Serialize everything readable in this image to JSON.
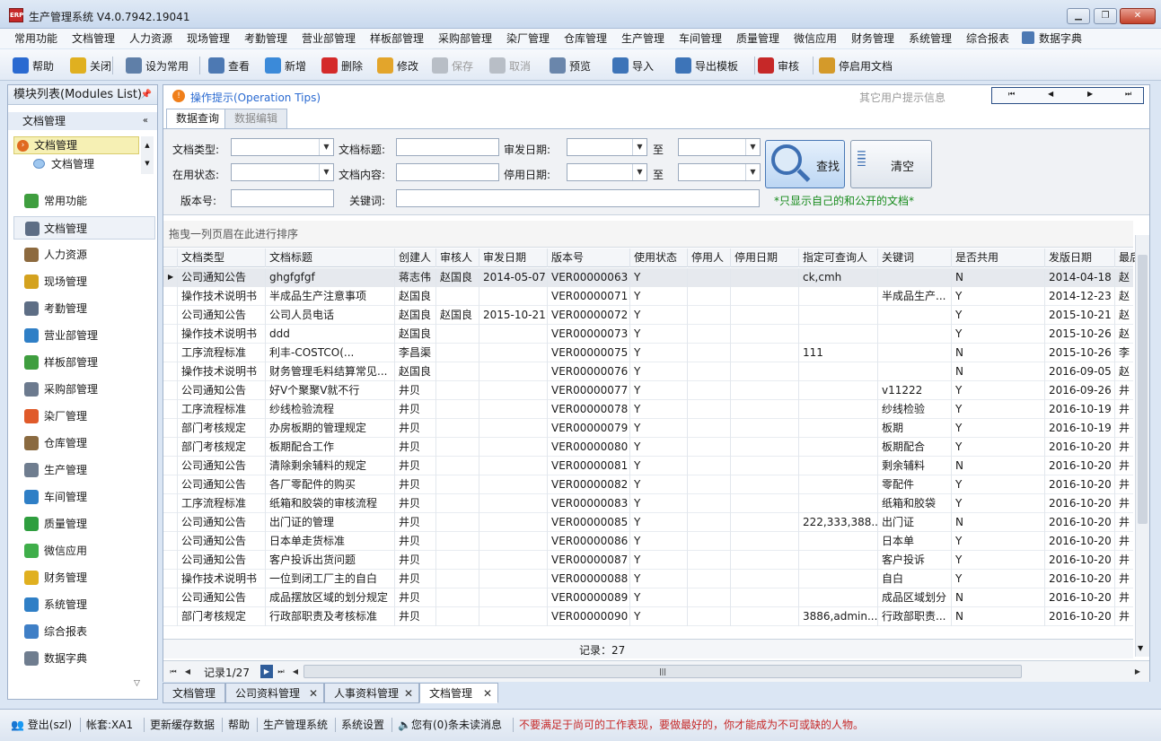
{
  "app": {
    "title": "生产管理系统 V4.0.7942.19041",
    "logo_text": "ERP"
  },
  "menu": [
    "常用功能",
    "文档管理",
    "人力资源",
    "现场管理",
    "考勤管理",
    "营业部管理",
    "样板部管理",
    "采购部管理",
    "染厂管理",
    "仓库管理",
    "生产管理",
    "车间管理",
    "质量管理",
    "微信应用",
    "财务管理",
    "系统管理",
    "综合报表",
    "数据字典"
  ],
  "toolbar": [
    {
      "label": "帮助",
      "icon": "help-icon",
      "color": "#2a6ad1",
      "enabled": true
    },
    {
      "label": "关闭",
      "icon": "exit-icon",
      "color": "#e0b020",
      "enabled": true
    },
    {
      "label": "设为常用",
      "icon": "printer-icon",
      "color": "#5f7fa8",
      "enabled": true
    },
    {
      "label": "查看",
      "icon": "view-icon",
      "color": "#4d79b3",
      "enabled": true
    },
    {
      "label": "新增",
      "icon": "new-doc-icon",
      "color": "#3b8ad9",
      "enabled": true
    },
    {
      "label": "删除",
      "icon": "delete-icon",
      "color": "#d42a2a",
      "enabled": true
    },
    {
      "label": "修改",
      "icon": "pencil-icon",
      "color": "#e3a52b",
      "enabled": true
    },
    {
      "label": "保存",
      "icon": "save-icon",
      "color": "#b8bec6",
      "enabled": false
    },
    {
      "label": "取消",
      "icon": "cancel-icon",
      "color": "#b8bec6",
      "enabled": false
    },
    {
      "label": "预览",
      "icon": "preview-icon",
      "color": "#6a86ab",
      "enabled": true
    },
    {
      "label": "导入",
      "icon": "import-icon",
      "color": "#3d74b8",
      "enabled": true
    },
    {
      "label": "导出模板",
      "icon": "export-icon",
      "color": "#3d74b8",
      "enabled": true
    },
    {
      "label": "审核",
      "icon": "stamp-icon",
      "color": "#c62828",
      "enabled": true
    },
    {
      "label": "停启用文档",
      "icon": "lock-icon",
      "color": "#d49a2a",
      "enabled": true
    }
  ],
  "left_panel": {
    "header": "模块列表(Modules List)",
    "section": "文档管理",
    "tree": [
      {
        "label": "文档管理",
        "selected": true
      },
      {
        "label": "文档管理",
        "selected": false
      }
    ],
    "nav": [
      {
        "label": "常用功能",
        "icon": "common-icon",
        "color": "#3f9e3f"
      },
      {
        "label": "文档管理",
        "icon": "document-icon",
        "color": "#5e6e85",
        "active": true
      },
      {
        "label": "人力资源",
        "icon": "people-icon",
        "color": "#8d6a3f"
      },
      {
        "label": "现场管理",
        "icon": "crown-icon",
        "color": "#d4a21f"
      },
      {
        "label": "考勤管理",
        "icon": "clock-icon",
        "color": "#5e6e85"
      },
      {
        "label": "营业部管理",
        "icon": "globe-icon",
        "color": "#2f7fc6"
      },
      {
        "label": "样板部管理",
        "icon": "puzzle-icon",
        "color": "#3f9e3f"
      },
      {
        "label": "采购部管理",
        "icon": "list-icon",
        "color": "#6c7a8e"
      },
      {
        "label": "染厂管理",
        "icon": "pie-icon",
        "color": "#e05a2a"
      },
      {
        "label": "仓库管理",
        "icon": "box-icon",
        "color": "#8a6a40"
      },
      {
        "label": "生产管理",
        "icon": "wrench-icon",
        "color": "#6f7d8f"
      },
      {
        "label": "车间管理",
        "icon": "org-icon",
        "color": "#2f7fc6"
      },
      {
        "label": "质量管理",
        "icon": "flag-icon",
        "color": "#2f9e3f"
      },
      {
        "label": "微信应用",
        "icon": "wechat-icon",
        "color": "#3fae4a"
      },
      {
        "label": "财务管理",
        "icon": "shield-icon",
        "color": "#e0b020"
      },
      {
        "label": "系统管理",
        "icon": "tools-icon",
        "color": "#2f7fc6"
      },
      {
        "label": "综合报表",
        "icon": "bar-chart-icon",
        "color": "#3f7fc6"
      },
      {
        "label": "数据字典",
        "icon": "book-icon",
        "color": "#6f7d8f"
      }
    ]
  },
  "tips": {
    "title": "操作提示(Operation Tips)",
    "other": "其它用户提示信息"
  },
  "tabs": [
    {
      "label": "数据查询",
      "active": true
    },
    {
      "label": "数据编辑",
      "active": false
    }
  ],
  "query": {
    "doc_type": "文档类型:",
    "doc_title": "文档标题:",
    "issue_date": "审发日期:",
    "to1": "至",
    "status": "在用状态:",
    "doc_content": "文档内容:",
    "stop_date": "停用日期:",
    "to2": "至",
    "version": "版本号:",
    "keyword": "关键词:",
    "find_button": "查找",
    "clear_button": "清空",
    "note": "*只显示自己的和公开的文档*"
  },
  "grid": {
    "group_hint": "拖曳一列页眉在此进行排序",
    "columns": [
      "文档类型",
      "文档标题",
      "创建人",
      "审核人",
      "审发日期",
      "版本号",
      "使用状态",
      "停用人",
      "停用日期",
      "指定可查询人",
      "关键词",
      "是否共用",
      "发版日期",
      "最后"
    ],
    "rows": [
      [
        "公司通知公告",
        "ghgfgfgf",
        "蒋志伟",
        "赵国良",
        "2014-05-07",
        "VER00000063",
        "Y",
        "",
        "",
        "ck,cmh",
        "",
        "N",
        "2014-04-18",
        "赵"
      ],
      [
        "操作技术说明书",
        "半成品生产注意事项",
        "赵国良",
        "",
        "",
        "VER00000071",
        "Y",
        "",
        "",
        "",
        "半成品生产...",
        "Y",
        "2014-12-23",
        "赵"
      ],
      [
        "公司通知公告",
        "公司人员电话",
        "赵国良",
        "赵国良",
        "2015-10-21",
        "VER00000072",
        "Y",
        "",
        "",
        "",
        "",
        "Y",
        "2015-10-21",
        "赵"
      ],
      [
        "操作技术说明书",
        "ddd",
        "赵国良",
        "",
        "",
        "VER00000073",
        "Y",
        "",
        "",
        "",
        "",
        "Y",
        "2015-10-26",
        "赵"
      ],
      [
        "工序流程标准",
        "          利丰-COSTCO(...",
        "李昌渠",
        "",
        "",
        "VER00000075",
        "Y",
        "",
        "",
        "111",
        "",
        "N",
        "2015-10-26",
        "李"
      ],
      [
        "操作技术说明书",
        "财务管理毛料结算常见...",
        "赵国良",
        "",
        "",
        "VER00000076",
        "Y",
        "",
        "",
        "",
        "",
        "N",
        "2016-09-05",
        "赵"
      ],
      [
        "公司通知公告",
        "好V个聚聚V就不行",
        "井贝",
        "",
        "",
        "VER00000077",
        "Y",
        "",
        "",
        "",
        "v11222",
        "Y",
        "2016-09-26",
        "井"
      ],
      [
        "工序流程标准",
        "纱线检验流程",
        "井贝",
        "",
        "",
        "VER00000078",
        "Y",
        "",
        "",
        "",
        "纱线检验",
        "Y",
        "2016-10-19",
        "井"
      ],
      [
        "部门考核规定",
        "办房板期的管理规定",
        "井贝",
        "",
        "",
        "VER00000079",
        "Y",
        "",
        "",
        "",
        "板期",
        "Y",
        "2016-10-19",
        "井"
      ],
      [
        "部门考核规定",
        "板期配合工作",
        "井贝",
        "",
        "",
        "VER00000080",
        "Y",
        "",
        "",
        "",
        "板期配合",
        "Y",
        "2016-10-20",
        "井"
      ],
      [
        "公司通知公告",
        "清除剩余辅料的规定",
        "井贝",
        "",
        "",
        "VER00000081",
        "Y",
        "",
        "",
        "",
        "剩余辅料",
        "N",
        "2016-10-20",
        "井"
      ],
      [
        "公司通知公告",
        "各厂零配件的购买",
        "井贝",
        "",
        "",
        "VER00000082",
        "Y",
        "",
        "",
        "",
        "零配件",
        "Y",
        "2016-10-20",
        "井"
      ],
      [
        "工序流程标准",
        "纸箱和胶袋的审核流程",
        "井贝",
        "",
        "",
        "VER00000083",
        "Y",
        "",
        "",
        "",
        "纸箱和胶袋",
        "Y",
        "2016-10-20",
        "井"
      ],
      [
        "公司通知公告",
        "出门证的管理",
        "井贝",
        "",
        "",
        "VER00000085",
        "Y",
        "",
        "",
        "222,333,388...",
        "出门证",
        "N",
        "2016-10-20",
        "井"
      ],
      [
        "公司通知公告",
        "日本单走货标准",
        "井贝",
        "",
        "",
        "VER00000086",
        "Y",
        "",
        "",
        "",
        "日本单",
        "Y",
        "2016-10-20",
        "井"
      ],
      [
        "公司通知公告",
        "客户投诉出货问题",
        "井贝",
        "",
        "",
        "VER00000087",
        "Y",
        "",
        "",
        "",
        "客户投诉",
        "Y",
        "2016-10-20",
        "井"
      ],
      [
        "操作技术说明书",
        "一位到闭工厂主的自白",
        "井贝",
        "",
        "",
        "VER00000088",
        "Y",
        "",
        "",
        "",
        "自白",
        "Y",
        "2016-10-20",
        "井"
      ],
      [
        "公司通知公告",
        "成品摆放区域的划分规定",
        "井贝",
        "",
        "",
        "VER00000089",
        "Y",
        "",
        "",
        "",
        "成品区域划分",
        "N",
        "2016-10-20",
        "井"
      ],
      [
        "部门考核规定",
        "行政部职责及考核标准",
        "井贝",
        "",
        "",
        "VER00000090",
        "Y",
        "",
        "",
        "3886,admin...",
        "行政部职责...",
        "N",
        "2016-10-20",
        "井"
      ]
    ],
    "footer": "记录：27",
    "pager": "记录1/27"
  },
  "doc_tabs": [
    {
      "label": "文档管理",
      "closable": false,
      "active": false
    },
    {
      "label": "公司资料管理",
      "closable": true,
      "active": false
    },
    {
      "label": "人事资料管理",
      "closable": true,
      "active": false
    },
    {
      "label": "文档管理",
      "closable": true,
      "active": true
    }
  ],
  "status": {
    "logout": "登出(szl)",
    "account": "帐套:XA1",
    "refresh": "更新缓存数据",
    "help": "帮助",
    "system": "生产管理系统",
    "settings": "系统设置",
    "messages": "您有(0)条未读消息",
    "motto": "不要满足于尚可的工作表现，要做最好的，你才能成为不可或缺的人物。"
  },
  "colors": {
    "accent": "#2a6ad1",
    "note": "#158a1a",
    "motto": "#c62828"
  }
}
